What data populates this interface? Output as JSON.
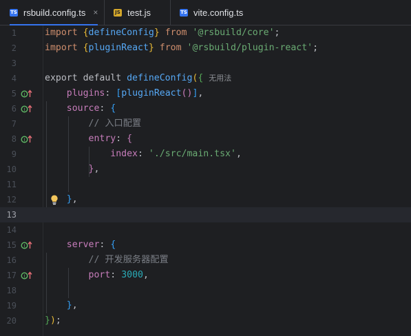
{
  "tabs": [
    {
      "label": "rsbuild.config.ts",
      "badge": "TS",
      "active": true
    },
    {
      "label": "test.js",
      "badge": "JS",
      "active": false
    },
    {
      "label": "vite.config.ts",
      "badge": "TS",
      "active": false
    }
  ],
  "tab_close": "×",
  "editor": {
    "current_line": 13,
    "line_numbers": [
      "1",
      "2",
      "3",
      "4",
      "5",
      "6",
      "7",
      "8",
      "9",
      "10",
      "11",
      "12",
      "13",
      "14",
      "15",
      "16",
      "17",
      "18",
      "19",
      "20"
    ],
    "gutter_icon": "implementation-override-icon",
    "lines": {
      "l1": {
        "kw": "import",
        "b1o": "{",
        "name": "defineConfig",
        "b1c": "}",
        "from": "from",
        "str": "'@rsbuild/core'",
        "semi": ";"
      },
      "l2": {
        "kw": "import",
        "b1o": "{",
        "name": "pluginReact",
        "b1c": "}",
        "from": "from",
        "str": "'@rsbuild/plugin-react'",
        "semi": ";"
      },
      "l4": {
        "text": "export default",
        "fn": "defineConfig",
        "b1o": "(",
        "b2o": "{",
        "hint": "无用法"
      },
      "l5": {
        "prop": "plugins",
        "colon": ":",
        "b3o": "[",
        "fn": "pluginReact",
        "b4": "()",
        "b3c": "]",
        "comma": ","
      },
      "l6": {
        "prop": "source",
        "colon": ":",
        "b3o": "{"
      },
      "l7": {
        "comment": "// 入口配置"
      },
      "l8": {
        "prop": "entry",
        "colon": ":",
        "b4o": "{"
      },
      "l9": {
        "prop": "index",
        "colon": ":",
        "str": "'./src/main.tsx'",
        "comma": ","
      },
      "l10": {
        "b4c": "}",
        "comma": ","
      },
      "l12": {
        "b3c": "}",
        "comma": ","
      },
      "l15": {
        "prop": "server",
        "colon": ":",
        "b3o": "{"
      },
      "l16": {
        "comment": "// 开发服务器配置"
      },
      "l17": {
        "prop": "port",
        "colon": ":",
        "num": "3000",
        "comma": ","
      },
      "l19": {
        "b3c": "}",
        "comma": ","
      },
      "l20": {
        "b2c": "}",
        "b1c": ")",
        "semi": ";"
      }
    }
  },
  "colors": {
    "keyword": "#cf8e6d",
    "function": "#56a8f5",
    "string": "#6aab73",
    "property": "#c77dbb",
    "number": "#2aacb8",
    "comment": "#7a7e85",
    "accent": "#3574f0"
  }
}
